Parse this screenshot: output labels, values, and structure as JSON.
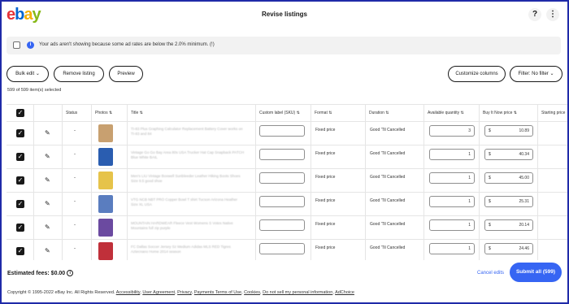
{
  "brand": {
    "logo_e": "e",
    "logo_b": "b",
    "logo_a": "a",
    "logo_y": "y"
  },
  "header": {
    "title": "Revise listings",
    "help": "?",
    "more": "⋮"
  },
  "notice": {
    "text": "Your ads aren't showing because some ad rates are below the 2.0% minimum. (!)"
  },
  "toolbar": {
    "bulk_edit": "Bulk edit ⌄",
    "remove": "Remove listing",
    "preview": "Preview",
    "customize": "Customize columns",
    "filter": "Filter: No filter ⌄"
  },
  "selection_count": "599 of 599 item(s) selected",
  "columns": {
    "status": "Status",
    "photos": "Photos ⇅",
    "title": "Title ⇅",
    "custom_label": "Custom label (SKU) ⇅",
    "format": "Format ⇅",
    "duration": "Duration ⇅",
    "quantity": "Available quantity ⇅",
    "price": "Buy It Now price ⇅",
    "starting": "Starting price"
  },
  "rows": [
    {
      "status": "-",
      "photo_color": "#c8a070",
      "title": "TI-83 Plus Graphing Calculator Replacement Battery Cover works on TI-83 and 84",
      "format": "Fixed price",
      "duration": "Good 'Til Cancelled",
      "qty": "3",
      "currency": "$",
      "price": "10.89"
    },
    {
      "status": "-",
      "photo_color": "#2a5db0",
      "title": "Vintage Go Go Bay Area 80s USA Trucker Hat Cap Snapback PATCH Blue White BAIL",
      "format": "Fixed price",
      "duration": "Good 'Til Cancelled",
      "qty": "1",
      "currency": "$",
      "price": "40.34"
    },
    {
      "status": "-",
      "photo_color": "#e6c34a",
      "title": "Men's LIU Vintage Boxwell Sunbleeder Leather Hiking Boots Shoes Size 9.5 good shoe",
      "format": "Fixed price",
      "duration": "Good 'Til Cancelled",
      "qty": "1",
      "currency": "$",
      "price": "45.00"
    },
    {
      "status": "-",
      "photo_color": "#5a7dbf",
      "title": "VTG NCB NBT PRO Copper Bowl T shirt Tucson Arizona Heather Size XL USA",
      "format": "Fixed price",
      "duration": "Good 'Til Cancelled",
      "qty": "1",
      "currency": "$",
      "price": "25.31"
    },
    {
      "status": "-",
      "photo_color": "#6b4aa0",
      "title": "MOUNTAIN HARDWEAR Fleece Vest Womens S Votes Native Mountains full zip purple",
      "format": "Fixed price",
      "duration": "Good 'Til Cancelled",
      "qty": "1",
      "currency": "$",
      "price": "20.14"
    },
    {
      "status": "-",
      "photo_color": "#c0303a",
      "title": "FC Dallas Soccer Jersey Sz Medium Adidas MLS RED Tigres Aztecnano Home 2014 season",
      "format": "Fixed price",
      "duration": "Good 'Til Cancelled",
      "qty": "1",
      "currency": "$",
      "price": "24.46"
    }
  ],
  "footer": {
    "fees": "Estimated fees: $0.00",
    "fees_icon": "i",
    "cancel": "Cancel edits",
    "submit": "Submit all (599)",
    "copyright_prefix": "Copyright © 1995-2022 eBay Inc. All Rights Reserved.",
    "links": [
      "Accessibility",
      "User Agreement",
      "Privacy",
      "Payments Terms of Use",
      "Cookies",
      "Do not sell my personal information",
      "AdChoice"
    ]
  },
  "colors": {
    "accent": "#3665f3",
    "frame": "#1f2aa8"
  }
}
